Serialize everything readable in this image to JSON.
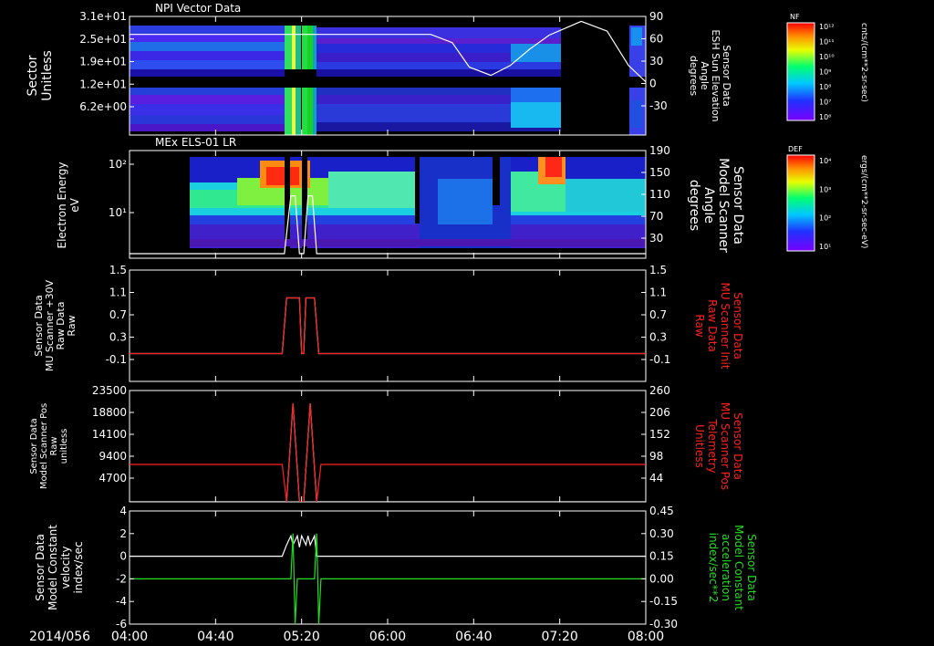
{
  "date_label": "2014/056",
  "x_ticks": [
    "04:00",
    "04:40",
    "05:20",
    "06:00",
    "06:40",
    "07:20",
    "08:00"
  ],
  "colors": {
    "white": "#ffffff",
    "red": "#ff2020",
    "green": "#22dd22",
    "background": "#000000"
  },
  "chart_data": [
    {
      "id": "npi",
      "type": "heatmap",
      "title": "NPI Vector Data",
      "ylabel": [
        "Sector",
        "Unitless"
      ],
      "y_ticks": [
        "3.1e+01",
        "2.5e+01",
        "1.9e+01",
        "1.2e+01",
        "6.2e+00"
      ],
      "y2label": [
        "Sensor Data",
        "ESH Sun Elevation",
        "Angle",
        "degrees"
      ],
      "y2_ticks": [
        "90",
        "60",
        "30",
        "0",
        "-30"
      ],
      "y2lim": [
        -55,
        90
      ],
      "colorbar": {
        "label": "NF",
        "unit": "cnts/(cm**2-sr-sec)",
        "ticks": [
          "10¹²",
          "10¹¹",
          "10¹⁰",
          "10⁹",
          "10⁸",
          "10⁷",
          "10⁶"
        ]
      },
      "overlay_series": {
        "name": "ESH Sun Elevation Angle",
        "color": "white",
        "x": [
          "04:00",
          "05:00",
          "05:08",
          "06:20",
          "06:30",
          "06:38",
          "06:48",
          "06:57",
          "07:06",
          "07:15",
          "07:30",
          "07:42",
          "07:52",
          "08:00"
        ],
        "y": [
          68,
          68,
          68,
          68,
          58,
          28,
          18,
          30,
          50,
          67,
          84,
          72,
          30,
          10
        ]
      }
    },
    {
      "id": "els",
      "type": "heatmap",
      "title": "MEx ELS-01 LR",
      "ylabel": [
        "Electron Energy",
        "eV"
      ],
      "y_ticks": [
        "10²",
        "10¹"
      ],
      "y2label": [
        "Sensor Data",
        "Model Scanner",
        "Angle",
        "degrees"
      ],
      "y2_ticks": [
        "190",
        "150",
        "110",
        "70",
        "30"
      ],
      "y2lim": [
        0,
        190
      ],
      "colorbar": {
        "label": "DEF",
        "unit": "ergs/(cm**2-sr-sec-eV)",
        "ticks": [
          "10⁴",
          "10³",
          "10²",
          "10¹"
        ]
      },
      "overlay_series": {
        "name": "Model Scanner Angle",
        "color": "white",
        "x": [
          "04:00",
          "05:10",
          "05:12",
          "05:15",
          "05:17",
          "05:19",
          "05:21",
          "05:23",
          "05:25",
          "05:27",
          "05:29",
          "08:00"
        ],
        "y": [
          8,
          8,
          8,
          110,
          110,
          8,
          8,
          110,
          110,
          8,
          8,
          8
        ]
      }
    },
    {
      "id": "mu_raw",
      "type": "line",
      "ylabel": [
        "Sensor Data",
        "MU Scanner +30V",
        "Raw Data",
        "Raw"
      ],
      "y_ticks": [
        "1.5",
        "1.1",
        "0.7",
        "0.3",
        "-0.1"
      ],
      "ylim": [
        -0.5,
        1.5
      ],
      "y2label": [
        "Sensor Data",
        "MU Scanner Init",
        "Raw Data",
        "Raw"
      ],
      "y2_ticks": [
        "1.5",
        "1.1",
        "0.7",
        "0.3",
        "-0.1"
      ],
      "series": [
        {
          "name": "MU Scanner +30V",
          "color": "white",
          "x": [
            "04:00",
            "05:11",
            "05:13",
            "05:19",
            "05:20",
            "05:21",
            "05:22",
            "05:26",
            "05:28",
            "08:00"
          ],
          "y": [
            0,
            0,
            1,
            1,
            0,
            0,
            1,
            1,
            0,
            0
          ]
        },
        {
          "name": "MU Scanner Init",
          "color": "red",
          "x": [
            "04:00",
            "05:11",
            "05:13",
            "05:19",
            "05:20",
            "05:21",
            "05:22",
            "05:26",
            "05:28",
            "08:00"
          ],
          "y": [
            0,
            0,
            1,
            1,
            0,
            0,
            1,
            1,
            0,
            0
          ]
        }
      ]
    },
    {
      "id": "mu_pos",
      "type": "line",
      "ylabel": [
        "Sensor Data",
        "Model Scanner Pos",
        "Raw",
        "unitless"
      ],
      "y_ticks": [
        "23500",
        "18800",
        "14100",
        "9400",
        "4700"
      ],
      "ylim": [
        0,
        23500
      ],
      "y2label": [
        "Sensor Data",
        "MU Scanner Pos",
        "Telemetry",
        "Unitless"
      ],
      "y2_ticks": [
        "260",
        "206",
        "152",
        "98",
        "44"
      ],
      "series": [
        {
          "name": "Model Scanner Pos",
          "color": "white",
          "x": [
            "04:00",
            "05:11",
            "05:13",
            "05:16",
            "05:19",
            "05:21",
            "05:24",
            "05:27",
            "05:29",
            "08:00"
          ],
          "y": [
            0,
            0,
            0,
            20800,
            0,
            0,
            20800,
            0,
            0,
            0
          ]
        },
        {
          "name": "MU Scanner Pos Telemetry",
          "color": "red",
          "x": [
            "04:00",
            "05:11",
            "05:13",
            "05:16",
            "05:19",
            "05:21",
            "05:24",
            "05:27",
            "05:29",
            "08:00"
          ],
          "y": [
            7900,
            7900,
            0,
            20800,
            0,
            0,
            20800,
            0,
            7900,
            7900
          ]
        }
      ]
    },
    {
      "id": "mu_vel",
      "type": "line",
      "ylabel": [
        "Sensor Data",
        "Model Constant",
        "velocity",
        "index/sec"
      ],
      "y_ticks": [
        "4",
        "2",
        "0",
        "-2",
        "-4",
        "-6"
      ],
      "ylim": [
        -6,
        4
      ],
      "y2label": [
        "Sensor Data",
        "Model Constant",
        "acceleration",
        "index/sec**2"
      ],
      "y2_ticks": [
        "0.45",
        "0.30",
        "0.15",
        "0.00",
        "-0.15",
        "-0.30"
      ],
      "series": [
        {
          "name": "Model Constant velocity",
          "color": "white",
          "x": [
            "04:00",
            "05:11",
            "05:13",
            "05:15",
            "05:16",
            "05:18",
            "05:19",
            "05:20",
            "05:22",
            "05:23",
            "05:24",
            "05:26",
            "05:27",
            "08:00"
          ],
          "y": [
            0,
            0,
            1.0,
            1.8,
            1.0,
            1.8,
            0.8,
            1.8,
            1.0,
            1.8,
            1.0,
            1.8,
            0,
            0
          ]
        },
        {
          "name": "Model Constant acceleration",
          "color": "green",
          "x": [
            "04:00",
            "05:15",
            "05:16",
            "05:17",
            "05:18",
            "05:26",
            "05:27",
            "05:28",
            "05:29",
            "08:00"
          ],
          "y": [
            -2,
            -2,
            2,
            -6,
            -2,
            -2,
            2,
            -6,
            -2,
            -2
          ]
        }
      ]
    }
  ]
}
